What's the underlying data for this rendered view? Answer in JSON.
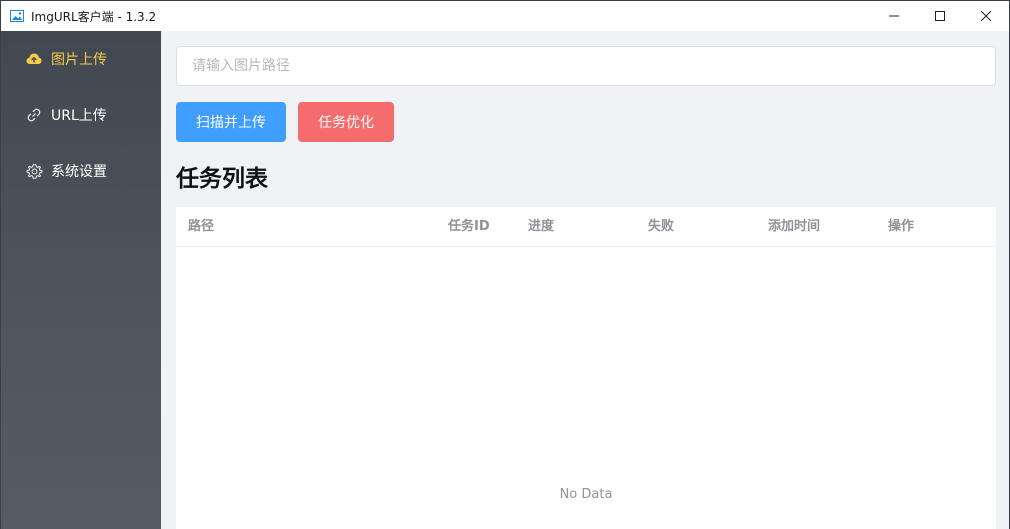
{
  "window": {
    "title": "ImgURL客户端 - 1.3.2",
    "controls": [
      "minimize-icon",
      "maximize-icon",
      "close-icon"
    ]
  },
  "sidebar": {
    "items": [
      {
        "label": "图片上传",
        "icon": "cloud-upload-icon",
        "active": true
      },
      {
        "label": "URL上传",
        "icon": "link-icon",
        "active": false
      },
      {
        "label": "系统设置",
        "icon": "gear-icon",
        "active": false
      }
    ]
  },
  "main": {
    "path_input": {
      "placeholder": "请输入图片路径",
      "value": ""
    },
    "buttons": {
      "scan_upload": "扫描并上传",
      "optimize": "任务优化"
    },
    "section_title": "任务列表",
    "table": {
      "columns": [
        "路径",
        "任务ID",
        "进度",
        "失败",
        "添加时间",
        "操作"
      ],
      "rows": [],
      "empty_text": "No Data"
    }
  },
  "colors": {
    "sidebar_bg": "#4d545b",
    "active_nav": "#f7c94b",
    "primary_button": "#409eff",
    "danger_button": "#f56c6c",
    "main_bg": "#f0f2f5"
  }
}
